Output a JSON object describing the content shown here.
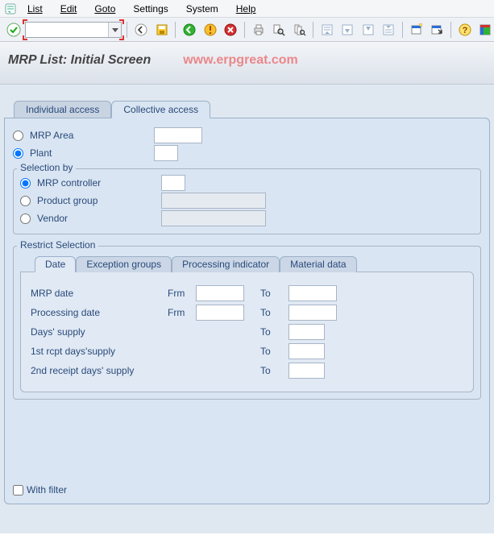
{
  "menu": {
    "items": [
      "List",
      "Edit",
      "Goto",
      "Settings",
      "System",
      "Help"
    ]
  },
  "toolbar": {
    "command_value": ""
  },
  "title": {
    "page_title": "MRP List: Initial Screen",
    "watermark": "www.erpgreat.com"
  },
  "outer_tabs": {
    "individual": "Individual access",
    "collective": "Collective access"
  },
  "scope": {
    "mrp_area_label": "MRP Area",
    "plant_label": "Plant",
    "mrp_area_value": "",
    "plant_value": ""
  },
  "selection_by": {
    "group_title": "Selection by",
    "mrp_controller_label": "MRP controller",
    "product_group_label": "Product group",
    "vendor_label": "Vendor",
    "mrp_controller_value": "",
    "product_group_value": "",
    "vendor_value": ""
  },
  "restrict": {
    "group_title": "Restrict Selection",
    "tabs": {
      "date": "Date",
      "exception_groups": "Exception groups",
      "processing_indicator": "Processing indicator",
      "material_data": "Material data"
    },
    "rows": {
      "mrp_date_label": "MRP date",
      "processing_date_label": "Processing date",
      "days_supply_label": "Days' supply",
      "first_rcpt_label": "1st rcpt days'supply",
      "second_rcpt_label": "2nd receipt days' supply",
      "frm_label": "Frm",
      "to_label": "To",
      "mrp_date_from": "",
      "mrp_date_to": "",
      "proc_date_from": "",
      "proc_date_to": "",
      "days_supply_to": "",
      "first_rcpt_to": "",
      "second_rcpt_to": ""
    }
  },
  "with_filter_label": "With filter"
}
